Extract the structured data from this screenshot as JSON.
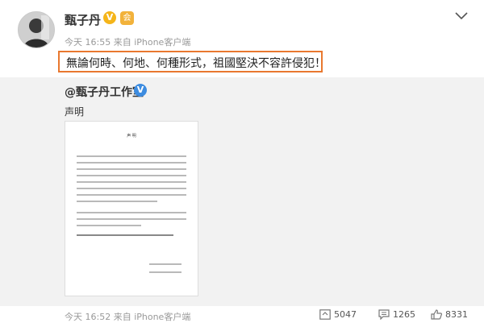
{
  "post": {
    "username": "甄子丹",
    "verified_mark": "V",
    "member_mark": "会",
    "meta": "今天 16:55 来自 iPhone客户端",
    "text": "無論何時、何地、何種形式，祖國堅決不容許侵犯！"
  },
  "repost": {
    "author": "@甄子丹工作室",
    "verified_mark": "V",
    "text": "声明",
    "document": {
      "title": "声 明"
    }
  },
  "footer": {
    "meta": "今天 16:52 来自 iPhone客户端",
    "repost_count": "5047",
    "comment_count": "1265",
    "like_count": "8331"
  },
  "colors": {
    "highlight": "#e9782f",
    "verified_gold": "#f5b51a",
    "verified_blue": "#3d8ce0"
  },
  "icons": [
    "chevron-down-icon",
    "repost-icon",
    "comment-icon",
    "like-icon"
  ]
}
